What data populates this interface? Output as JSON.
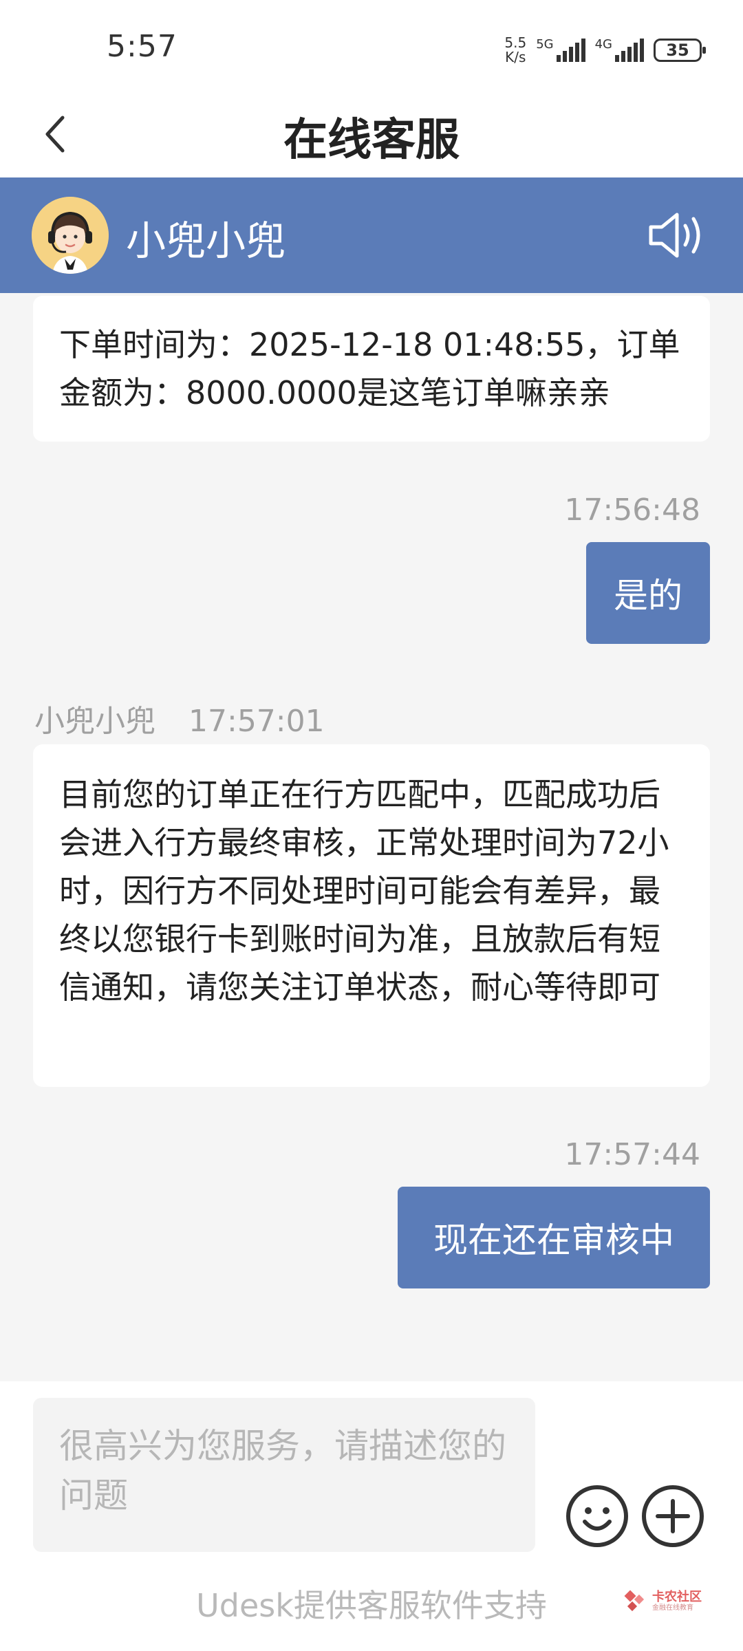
{
  "status_bar": {
    "time": "5:57",
    "speed_value": "5.5",
    "speed_unit": "K/s",
    "net1": "5G",
    "net2": "4G",
    "battery": "35"
  },
  "header": {
    "title": "在线客服"
  },
  "agent": {
    "name": "小兜小兜",
    "avatar_icon": "agent-avatar-icon",
    "speaker_icon": "speaker-icon"
  },
  "messages": [
    {
      "from": "agent",
      "text": "下单时间为：2025-12-18 01:48:55，订单金额为：8000.0000是这笔订单嘛亲亲"
    },
    {
      "from": "user",
      "time": "17:56:48",
      "text": "是的"
    },
    {
      "from": "agent",
      "sender": "小兜小兜",
      "time": "17:57:01",
      "text": "目前您的订单正在行方匹配中，匹配成功后会进入行方最终审核，正常处理时间为72小时，因行方不同处理时间可能会有差异，最终以您银行卡到账时间为准，且放款后有短信通知，请您关注订单状态，耐心等待即可"
    },
    {
      "from": "user",
      "time": "17:57:44",
      "text": "现在还在审核中"
    }
  ],
  "input": {
    "placeholder": "很高兴为您服务，请描述您的问题"
  },
  "footer": {
    "text": "Udesk提供客服软件支持"
  },
  "watermark": {
    "title": "卡农社区",
    "subtitle": "金融在线教育"
  },
  "colors": {
    "accent": "#5b7cb8",
    "background": "#f5f5f5"
  }
}
